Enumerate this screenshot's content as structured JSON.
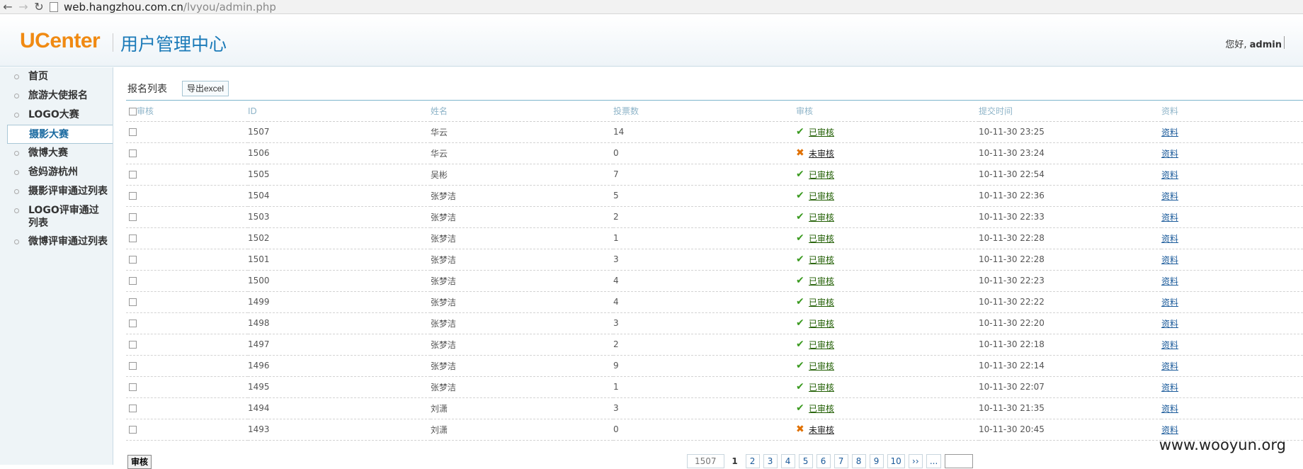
{
  "browser": {
    "url_host": "web.hangzhou.com.cn",
    "url_path": "/lvyou/admin.php"
  },
  "header": {
    "logo": "UCenter",
    "subtitle": "用户管理中心",
    "greeting": "您好, ",
    "username": "admin"
  },
  "sidebar": {
    "items": [
      {
        "label": "首页"
      },
      {
        "label": "旅游大使报名"
      },
      {
        "label": "LOGO大赛"
      },
      {
        "label": "摄影大赛"
      },
      {
        "label": "微博大赛"
      },
      {
        "label": "爸妈游杭州"
      },
      {
        "label": "摄影评审通过列表"
      },
      {
        "label": "LOGO评审通过列表"
      },
      {
        "label": "微博评审通过列表"
      }
    ]
  },
  "main": {
    "title": "报名列表",
    "export_label": "导出excel",
    "columns": [
      "审核",
      "ID",
      "姓名",
      "投票数",
      "审核",
      "提交时间",
      "资料"
    ],
    "rows": [
      {
        "id": "1507",
        "name": "华云",
        "votes": "14",
        "approved": true,
        "status": "已审核",
        "time": "10-11-30 23:25",
        "info": "资料"
      },
      {
        "id": "1506",
        "name": "华云",
        "votes": "0",
        "approved": false,
        "status": "未审核",
        "time": "10-11-30 23:24",
        "info": "资料"
      },
      {
        "id": "1505",
        "name": "吴彬",
        "votes": "7",
        "approved": true,
        "status": "已审核",
        "time": "10-11-30 22:54",
        "info": "资料"
      },
      {
        "id": "1504",
        "name": "张梦洁",
        "votes": "5",
        "approved": true,
        "status": "已审核",
        "time": "10-11-30 22:36",
        "info": "资料"
      },
      {
        "id": "1503",
        "name": "张梦洁",
        "votes": "2",
        "approved": true,
        "status": "已审核",
        "time": "10-11-30 22:33",
        "info": "资料"
      },
      {
        "id": "1502",
        "name": "张梦洁",
        "votes": "1",
        "approved": true,
        "status": "已审核",
        "time": "10-11-30 22:28",
        "info": "资料"
      },
      {
        "id": "1501",
        "name": "张梦洁",
        "votes": "3",
        "approved": true,
        "status": "已审核",
        "time": "10-11-30 22:28",
        "info": "资料"
      },
      {
        "id": "1500",
        "name": "张梦洁",
        "votes": "4",
        "approved": true,
        "status": "已审核",
        "time": "10-11-30 22:23",
        "info": "资料"
      },
      {
        "id": "1499",
        "name": "张梦洁",
        "votes": "4",
        "approved": true,
        "status": "已审核",
        "time": "10-11-30 22:22",
        "info": "资料"
      },
      {
        "id": "1498",
        "name": "张梦洁",
        "votes": "3",
        "approved": true,
        "status": "已审核",
        "time": "10-11-30 22:20",
        "info": "资料"
      },
      {
        "id": "1497",
        "name": "张梦洁",
        "votes": "2",
        "approved": true,
        "status": "已审核",
        "time": "10-11-30 22:18",
        "info": "资料"
      },
      {
        "id": "1496",
        "name": "张梦洁",
        "votes": "9",
        "approved": true,
        "status": "已审核",
        "time": "10-11-30 22:14",
        "info": "资料"
      },
      {
        "id": "1495",
        "name": "张梦洁",
        "votes": "1",
        "approved": true,
        "status": "已审核",
        "time": "10-11-30 22:07",
        "info": "资料"
      },
      {
        "id": "1494",
        "name": "刘潇",
        "votes": "3",
        "approved": true,
        "status": "已审核",
        "time": "10-11-30 21:35",
        "info": "资料"
      },
      {
        "id": "1493",
        "name": "刘潇",
        "votes": "0",
        "approved": false,
        "status": "未审核",
        "time": "10-11-30 20:45",
        "info": "资料"
      }
    ],
    "audit_button": "审核"
  },
  "pager": {
    "total": "1507",
    "pages": [
      "1",
      "2",
      "3",
      "4",
      "5",
      "6",
      "7",
      "8",
      "9",
      "10"
    ],
    "current": "1",
    "next": "››",
    "ellipsis": "..."
  },
  "watermark": "www.wooyun.org",
  "colors": {
    "logo": "#f08a12",
    "subtitle": "#1a7ab8",
    "approved": "#3a9a1f",
    "pending": "#e07000"
  }
}
